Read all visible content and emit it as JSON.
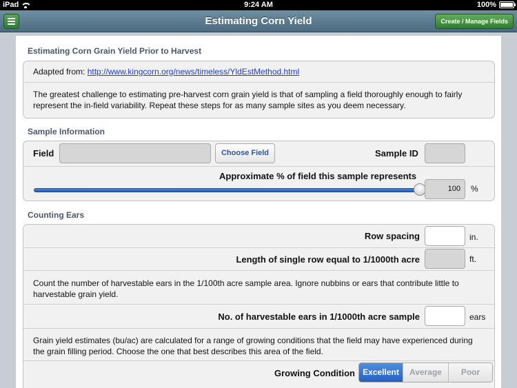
{
  "status_bar": {
    "device": "iPad",
    "time": "9:24 AM",
    "battery": "100%"
  },
  "nav": {
    "title": "Estimating Corn Yield",
    "create_button": "Create / Manage Fields"
  },
  "intro": {
    "heading": "Estimating Corn Grain Yield Prior to Harvest",
    "adapted_prefix": "Adapted from: ",
    "adapted_link": "http://www.kingcorn.org/news/timeless/YldEstMethod.html",
    "description": "The greatest challenge to estimating pre-harvest corn grain yield is that of sampling a field thoroughly enough to fairly represent the in-field variability. Repeat these steps for as many sample sites as you deem necessary."
  },
  "sample": {
    "heading": "Sample Information",
    "field_label": "Field",
    "field_value": "",
    "choose_field": "Choose Field",
    "sample_id_label": "Sample ID",
    "sample_id_value": "",
    "percent_label": "Approximate % of field this sample represents",
    "percent_value": "100",
    "percent_unit": "%",
    "slider_fraction": 1.0
  },
  "counting": {
    "heading": "Counting Ears",
    "row_spacing_label": "Row spacing",
    "row_spacing_value": "",
    "row_spacing_unit": "in.",
    "row_length_label": "Length of single row equal to 1/1000th acre",
    "row_length_value": "",
    "row_length_unit": "ft.",
    "count_instructions": "Count the number of harvestable ears in the 1/100th acre sample area.  Ignore nubbins or ears that contribute little to harvestable grain yield.",
    "ears_label": "No. of harvestable ears in 1/1000th acre sample",
    "ears_value": "",
    "ears_unit": "ears",
    "yield_instructions": "Grain yield estimates (bu/ac) are calculated for a range of growing conditions that the field may have experienced during the grain filling period. Choose the one that best describes this area of the field.",
    "growing_label": "Growing Condition",
    "conditions": [
      "Excellent",
      "Average",
      "Poor"
    ],
    "selected_condition": "Excellent"
  },
  "colors": {
    "accent_blue": "#2460c4",
    "nav_green": "#2f7d30",
    "link": "#1d3bd8"
  }
}
